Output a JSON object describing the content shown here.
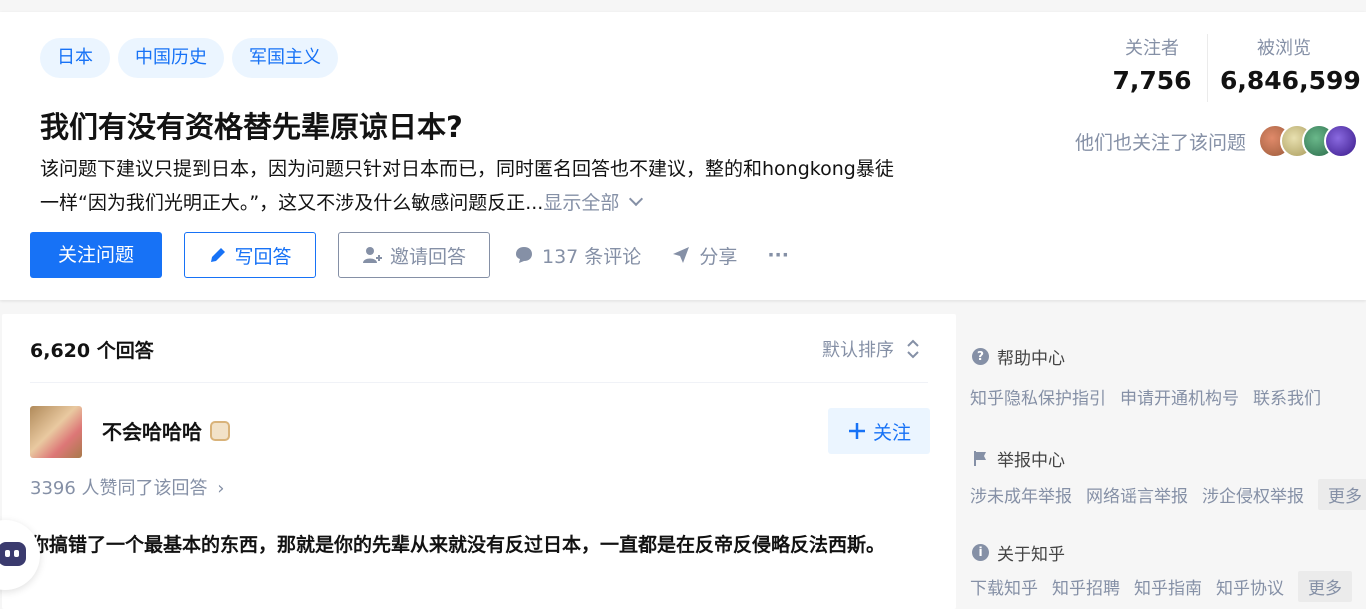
{
  "question": {
    "topics": [
      "日本",
      "中国历史",
      "军国主义"
    ],
    "title": "我们有没有资格替先辈原谅日本?",
    "description_line1": "该问题下建议只提到日本，因为问题只针对日本而已，同时匿名回答也不建议，整的和hongkong暴徒",
    "description_line2": "一样“因为我们光明正大。”，这又不涉及什么敏感问题反正...",
    "show_all": "显示全部"
  },
  "stats": {
    "followers_label": "关注者",
    "followers": "7,756",
    "views_label": "被浏览",
    "views": "6,846,599"
  },
  "also_follow": "他们也关注了该问题",
  "actions": {
    "follow": "关注问题",
    "write": "写回答",
    "invite": "邀请回答",
    "comments": "137 条评论",
    "share": "分享",
    "more": "···"
  },
  "answers": {
    "count": "6,620 个回答",
    "sort": "默认排序",
    "author": "不会哈哈哈",
    "follow": "关注",
    "votes": "3396 人赞同了该回答",
    "content": "你搞错了一个最基本的东西，那就是你的先辈从来就没有反过日本，一直都是在反帝反侵略反法西斯。"
  },
  "sidebar": {
    "help_title": "帮助中心",
    "help_links": [
      "知乎隐私保护指引",
      "申请开通机构号",
      "联系我们"
    ],
    "report_title": "举报中心",
    "report_links": [
      "涉未成年举报",
      "网络谣言举报",
      "涉企侵权举报"
    ],
    "report_more": "更多",
    "about_title": "关于知乎",
    "about_links": [
      "下载知乎",
      "知乎招聘",
      "知乎指南",
      "知乎协议"
    ],
    "about_more": "更多"
  },
  "colors": {
    "brand": "#1772f6",
    "muted": "#8590a6",
    "tag_bg": "#ebf5ff"
  }
}
